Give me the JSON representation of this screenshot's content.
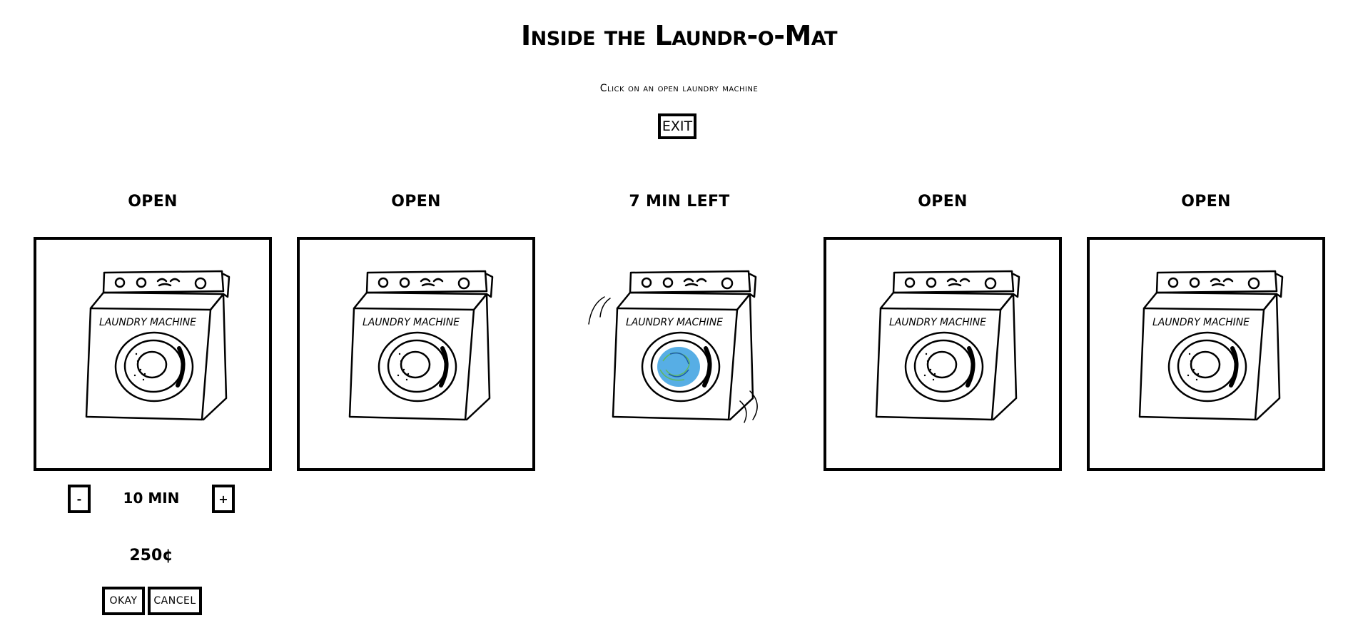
{
  "header": {
    "title": "Inside the Laundr-o-Mat",
    "instruction": "Click on an open laundry machine",
    "exit_label": "EXIT"
  },
  "machines": [
    {
      "status": "OPEN",
      "available": true
    },
    {
      "status": "OPEN",
      "available": true
    },
    {
      "status": "7 MIN LEFT",
      "available": false
    },
    {
      "status": "OPEN",
      "available": true
    },
    {
      "status": "OPEN",
      "available": true
    }
  ],
  "machine_art": {
    "label_text": "LAUNDRY MACHINE"
  },
  "order_panel": {
    "decrease_label": "-",
    "increase_label": "+",
    "duration": "10 MIN",
    "price": "250¢",
    "okay_label": "OKAY",
    "cancel_label": "CANCEL"
  },
  "icons": {
    "machine": "washing-machine-icon",
    "running_machine": "washing-machine-running-icon"
  },
  "colors": {
    "background": "#ffffff",
    "ink": "#000000",
    "suds_blue": "#3aa0e0",
    "suds_green": "#5fb85f"
  }
}
